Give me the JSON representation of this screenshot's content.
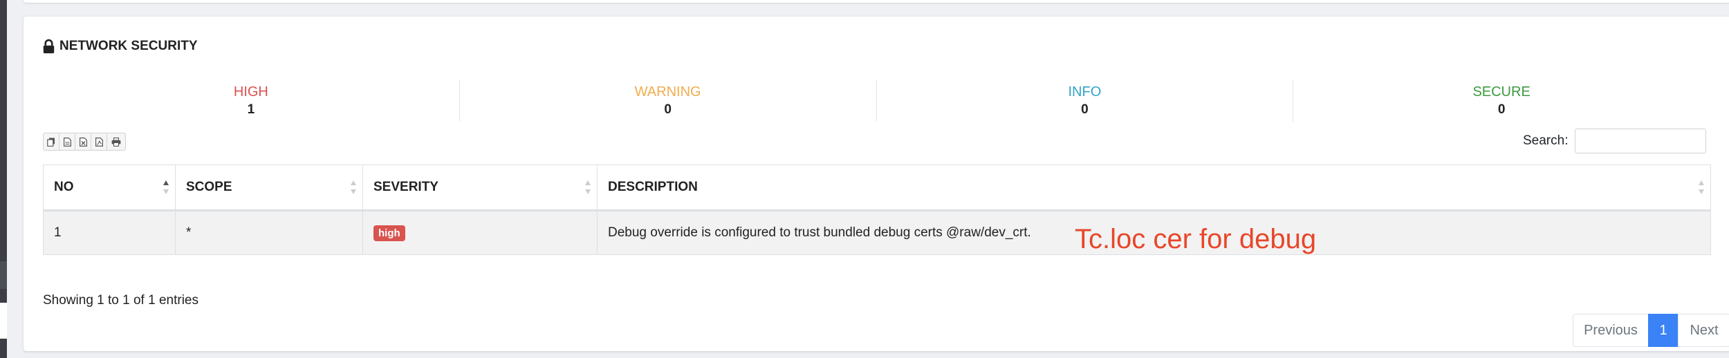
{
  "section": {
    "title": "NETWORK SECURITY"
  },
  "stats": [
    {
      "label": "HIGH",
      "value": "1",
      "color": "#d9534f"
    },
    {
      "label": "WARNING",
      "value": "0",
      "color": "#f0ad4e"
    },
    {
      "label": "INFO",
      "value": "0",
      "color": "#31a4c9"
    },
    {
      "label": "SECURE",
      "value": "0",
      "color": "#3c9a3f"
    }
  ],
  "toolbar": {
    "icons": [
      "copy-icon",
      "csv-icon",
      "excel-icon",
      "pdf-icon",
      "print-icon"
    ]
  },
  "search": {
    "label": "Search:",
    "value": "",
    "placeholder": ""
  },
  "table": {
    "columns": [
      "NO",
      "SCOPE",
      "SEVERITY",
      "DESCRIPTION"
    ],
    "rows": [
      {
        "no": "1",
        "scope": "*",
        "severity": "high",
        "description": "Debug override is configured to trust bundled debug certs @raw/dev_crt."
      }
    ]
  },
  "annotation": "Tc.loc cer for debug",
  "footer": {
    "info": "Showing 1 to 1 of 1 entries"
  },
  "pagination": {
    "previous": "Previous",
    "current": "1",
    "next": "Next"
  },
  "colors": {
    "accent": "#3b82f6",
    "high_badge": "#d9534f",
    "annotation": "#e8462a"
  }
}
